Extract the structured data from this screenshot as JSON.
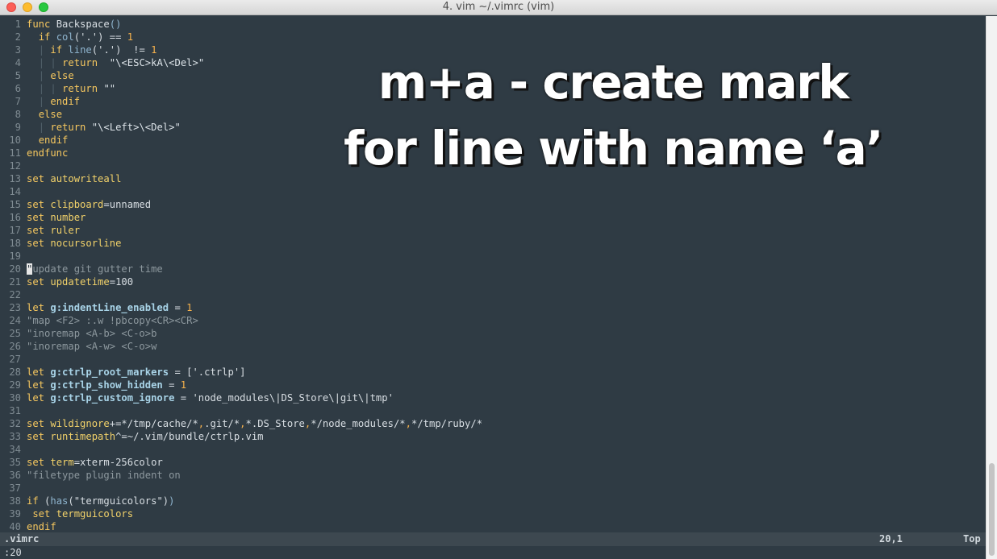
{
  "window": {
    "title": "4. vim ~/.vimrc (vim)"
  },
  "overlay": {
    "line1": "m+a - create mark",
    "line2": "for line with name ‘a’"
  },
  "statusline": {
    "filename": ".vimrc",
    "position": "20,1",
    "scroll": "Top"
  },
  "cmdline": {
    "text": ":20"
  },
  "editor": {
    "cursor_line": 20,
    "lines": [
      {
        "n": "1",
        "s": [
          [
            "kw",
            "func"
          ],
          [
            "",
            " Backspace"
          ],
          [
            "fn",
            "()"
          ]
        ]
      },
      {
        "n": "2",
        "s": [
          [
            "",
            "  "
          ],
          [
            "kw",
            "if"
          ],
          [
            "",
            " "
          ],
          [
            "fn",
            "col"
          ],
          [
            "",
            "('.') == "
          ],
          [
            "num",
            "1"
          ]
        ]
      },
      {
        "n": "3",
        "s": [
          [
            "",
            "  "
          ],
          [
            "ind",
            "|"
          ],
          [
            "",
            " "
          ],
          [
            "kw",
            "if"
          ],
          [
            "",
            " "
          ],
          [
            "fn",
            "line"
          ],
          [
            "",
            "('.')  != "
          ],
          [
            "num",
            "1"
          ]
        ]
      },
      {
        "n": "4",
        "s": [
          [
            "",
            "  "
          ],
          [
            "ind",
            "|"
          ],
          [
            "",
            " "
          ],
          [
            "ind",
            "|"
          ],
          [
            "",
            " "
          ],
          [
            "kw",
            "return"
          ],
          [
            "",
            "  "
          ],
          [
            "str",
            "\"\\<ESC>kA\\<Del>\""
          ]
        ]
      },
      {
        "n": "5",
        "s": [
          [
            "",
            "  "
          ],
          [
            "ind",
            "|"
          ],
          [
            "",
            " "
          ],
          [
            "kw",
            "else"
          ]
        ]
      },
      {
        "n": "6",
        "s": [
          [
            "",
            "  "
          ],
          [
            "ind",
            "|"
          ],
          [
            "",
            " "
          ],
          [
            "ind",
            "|"
          ],
          [
            "",
            " "
          ],
          [
            "kw",
            "return"
          ],
          [
            "",
            " "
          ],
          [
            "str",
            "\"\""
          ]
        ]
      },
      {
        "n": "7",
        "s": [
          [
            "",
            "  "
          ],
          [
            "ind",
            "|"
          ],
          [
            "",
            " "
          ],
          [
            "kw",
            "endif"
          ]
        ]
      },
      {
        "n": "8",
        "s": [
          [
            "",
            "  "
          ],
          [
            "kw",
            "else"
          ]
        ]
      },
      {
        "n": "9",
        "s": [
          [
            "",
            "  "
          ],
          [
            "ind",
            "|"
          ],
          [
            "",
            " "
          ],
          [
            "kw",
            "return"
          ],
          [
            "",
            " "
          ],
          [
            "str",
            "\"\\<Left>\\<Del>\""
          ]
        ]
      },
      {
        "n": "10",
        "s": [
          [
            "",
            "  "
          ],
          [
            "kw",
            "endif"
          ]
        ]
      },
      {
        "n": "11",
        "s": [
          [
            "kw",
            "endfunc"
          ]
        ]
      },
      {
        "n": "12",
        "s": []
      },
      {
        "n": "13",
        "s": [
          [
            "kw",
            "set"
          ],
          [
            "",
            " "
          ],
          [
            "opt",
            "autowriteall"
          ]
        ]
      },
      {
        "n": "14",
        "s": []
      },
      {
        "n": "15",
        "s": [
          [
            "kw",
            "set"
          ],
          [
            "",
            " "
          ],
          [
            "opt",
            "clipboard"
          ],
          [
            "",
            "=unnamed"
          ]
        ]
      },
      {
        "n": "16",
        "s": [
          [
            "kw",
            "set"
          ],
          [
            "",
            " "
          ],
          [
            "opt",
            "number"
          ]
        ]
      },
      {
        "n": "17",
        "s": [
          [
            "kw",
            "set"
          ],
          [
            "",
            " "
          ],
          [
            "opt",
            "ruler"
          ]
        ]
      },
      {
        "n": "18",
        "s": [
          [
            "kw",
            "set"
          ],
          [
            "",
            " "
          ],
          [
            "opt",
            "nocursorline"
          ]
        ]
      },
      {
        "n": "19",
        "s": []
      },
      {
        "n": "20",
        "s": [
          [
            "cursor",
            "\""
          ],
          [
            "cmt",
            "update git gutter time"
          ]
        ]
      },
      {
        "n": "21",
        "s": [
          [
            "kw",
            "set"
          ],
          [
            "",
            " "
          ],
          [
            "opt",
            "updatetime"
          ],
          [
            "",
            "=100"
          ]
        ]
      },
      {
        "n": "22",
        "s": []
      },
      {
        "n": "23",
        "s": [
          [
            "kw",
            "let"
          ],
          [
            "",
            " "
          ],
          [
            "var",
            "g:indentLine_enabled"
          ],
          [
            "",
            " = "
          ],
          [
            "num",
            "1"
          ]
        ]
      },
      {
        "n": "24",
        "s": [
          [
            "cmt",
            "\"map <F2> :.w !pbcopy<CR><CR>"
          ]
        ]
      },
      {
        "n": "25",
        "s": [
          [
            "cmt",
            "\"inoremap <A-b> <C-o>b"
          ]
        ]
      },
      {
        "n": "26",
        "s": [
          [
            "cmt",
            "\"inoremap <A-w> <C-o>w"
          ]
        ]
      },
      {
        "n": "27",
        "s": []
      },
      {
        "n": "28",
        "s": [
          [
            "kw",
            "let"
          ],
          [
            "",
            " "
          ],
          [
            "var",
            "g:ctrlp_root_markers"
          ],
          [
            "",
            " = ['.ctrlp']"
          ]
        ]
      },
      {
        "n": "29",
        "s": [
          [
            "kw",
            "let"
          ],
          [
            "",
            " "
          ],
          [
            "var",
            "g:ctrlp_show_hidden"
          ],
          [
            "",
            " = "
          ],
          [
            "num",
            "1"
          ]
        ]
      },
      {
        "n": "30",
        "s": [
          [
            "kw",
            "let"
          ],
          [
            "",
            " "
          ],
          [
            "var",
            "g:ctrlp_custom_ignore"
          ],
          [
            "",
            " = 'node_modules\\|DS_Store\\|git\\|tmp'"
          ]
        ]
      },
      {
        "n": "31",
        "s": []
      },
      {
        "n": "32",
        "s": [
          [
            "kw",
            "set"
          ],
          [
            "",
            " "
          ],
          [
            "opt",
            "wildignore"
          ],
          [
            "",
            "+=*/tmp/cache/*"
          ],
          [
            "num",
            ","
          ],
          [
            "",
            ".git/*"
          ],
          [
            "num",
            ","
          ],
          [
            "",
            "*.DS_Store"
          ],
          [
            "num",
            ","
          ],
          [
            "",
            "*/node_modules/*"
          ],
          [
            "num",
            ","
          ],
          [
            "",
            "*/tmp/ruby/*"
          ]
        ]
      },
      {
        "n": "33",
        "s": [
          [
            "kw",
            "set"
          ],
          [
            "",
            " "
          ],
          [
            "opt",
            "runtimepath"
          ],
          [
            "",
            "^=~/.vim/bundle/ctrlp.vim"
          ]
        ]
      },
      {
        "n": "34",
        "s": []
      },
      {
        "n": "35",
        "s": [
          [
            "kw",
            "set"
          ],
          [
            "",
            " "
          ],
          [
            "opt",
            "term"
          ],
          [
            "",
            "=xterm-256color"
          ]
        ]
      },
      {
        "n": "36",
        "s": [
          [
            "cmt",
            "\"filetype plugin indent on"
          ]
        ]
      },
      {
        "n": "37",
        "s": []
      },
      {
        "n": "38",
        "s": [
          [
            "kw",
            "if"
          ],
          [
            "",
            " ("
          ],
          [
            "fn",
            "has"
          ],
          [
            "",
            "(\"termguicolors\")"
          ],
          [
            "fn",
            ")"
          ]
        ]
      },
      {
        "n": "39",
        "s": [
          [
            "",
            " "
          ],
          [
            "kw",
            "set"
          ],
          [
            "",
            " "
          ],
          [
            "opt",
            "termguicolors"
          ]
        ]
      },
      {
        "n": "40",
        "s": [
          [
            "kw",
            "endif"
          ]
        ]
      }
    ]
  }
}
